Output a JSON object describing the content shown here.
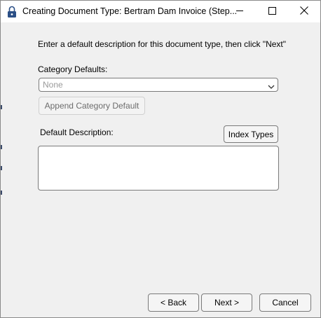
{
  "window": {
    "title": "Creating Document Type: Bertram Dam Invoice (Step...",
    "controls": [
      "minimize-icon",
      "maximize-icon",
      "close-icon"
    ]
  },
  "instruction": "Enter a default description for this document type, then click \"Next\"",
  "category_defaults": {
    "label": "Category Defaults:",
    "selected": "None"
  },
  "append_button": "Append Category Default",
  "default_description": {
    "label": "Default Description:",
    "value": ""
  },
  "index_types_button": "Index Types",
  "nav": {
    "back": "< Back",
    "next": "Next >",
    "cancel": "Cancel"
  },
  "colors": {
    "window_bg": "#f0f0f0",
    "titlebar_bg": "#ffffff",
    "border": "#7a7a7a",
    "disabled_text": "#9a9a9a"
  }
}
